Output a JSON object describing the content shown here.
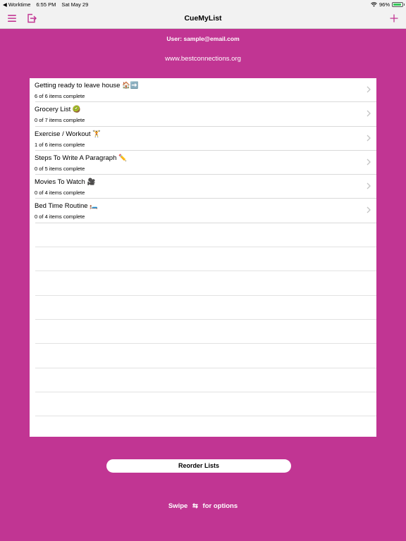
{
  "status_bar": {
    "back_app": "◀ Worktime",
    "time": "6:55 PM",
    "date": "Sat May 29",
    "battery_pct": "96%",
    "battery_level": 0.96
  },
  "nav": {
    "title": "CueMyList",
    "menu_icon": "hamburger-icon",
    "export_icon": "export-icon",
    "add_icon": "plus-icon",
    "accent": "#c13593"
  },
  "user_label": "User: sample@email.com",
  "website": "www.bestconnections.org",
  "lists": [
    {
      "title": "Getting ready to leave house 🏠➡️",
      "progress": "6 of 6 items complete"
    },
    {
      "title": "Grocery List 🥝",
      "progress": "0 of 7 items complete"
    },
    {
      "title": "Exercise / Workout 🏋️",
      "progress": "1 of 6 items complete"
    },
    {
      "title": "Steps To Write A Paragraph ✏️",
      "progress": "0 of 5 items complete"
    },
    {
      "title": "Movies To Watch 🎥",
      "progress": "0 of 4 items complete"
    },
    {
      "title": "Bed Time Routine 🛏️",
      "progress": "0 of 4 items complete"
    }
  ],
  "reorder_label": "Reorder Lists",
  "swipe_hint": {
    "before": "Swipe",
    "arrows": "⇆",
    "after": "for options"
  },
  "colors": {
    "background": "#c13593",
    "nav_bg": "#f2f2f2",
    "panel": "#ffffff"
  }
}
